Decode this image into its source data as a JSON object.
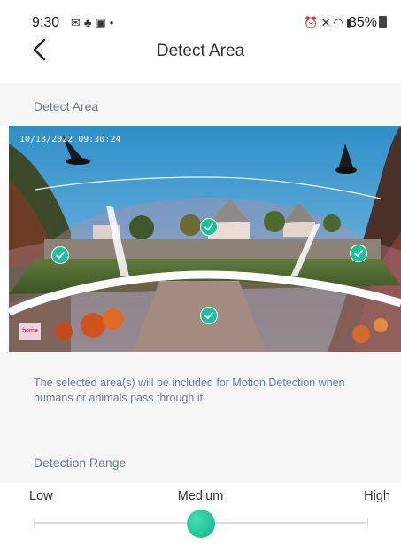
{
  "status_bar": {
    "time": "9:30",
    "left_icons": [
      "mail-icon",
      "person-icon",
      "notification-icon",
      "dot-icon"
    ],
    "right_icons": [
      "alarm-icon",
      "mute-icon",
      "wifi-icon",
      "signal-icon"
    ],
    "battery": "35%"
  },
  "header": {
    "title": "Detect Area",
    "back_icon": "chevron-left-icon"
  },
  "detect_area": {
    "label": "Detect Area",
    "timestamp": "10/13/2022 09:30:24",
    "camera_label": "home",
    "zones": [
      {
        "name": "left",
        "selected": true
      },
      {
        "name": "top-center",
        "selected": true
      },
      {
        "name": "right",
        "selected": true
      },
      {
        "name": "bottom-center",
        "selected": true
      }
    ],
    "description": "The selected area(s) will be included for Motion Detection when humans or animals pass through it."
  },
  "detection_range": {
    "label": "Detection Range",
    "options": [
      "Low",
      "Medium",
      "High"
    ],
    "selected": "Medium",
    "level": 0.5
  },
  "colors": {
    "accent": "#19c29a",
    "section_label": "#6b7c93",
    "band": "#f6f6f6"
  }
}
